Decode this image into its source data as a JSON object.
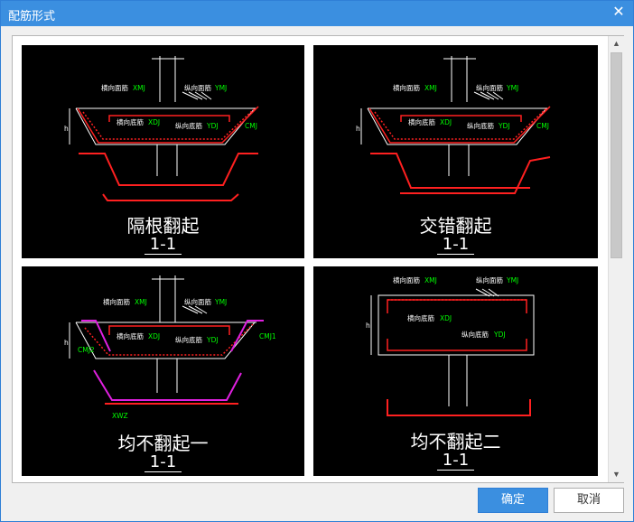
{
  "window": {
    "title": "配筋形式",
    "close_icon": "close-icon"
  },
  "panels": [
    {
      "caption": "隔根翻起",
      "section": "1-1",
      "labels": {
        "top_h": "横向面筋",
        "top_h_code": "XMJ",
        "top_v": "纵向面筋",
        "top_v_code": "YMJ",
        "bot_h": "横向底筋",
        "bot_h_code": "XDJ",
        "bot_v": "纵向底筋",
        "bot_v_code": "YDJ",
        "cmj": "CMJ",
        "h": "h"
      }
    },
    {
      "caption": "交错翻起",
      "section": "1-1",
      "labels": {
        "top_h": "横向面筋",
        "top_h_code": "XMJ",
        "top_v": "纵向面筋",
        "top_v_code": "YMJ",
        "bot_h": "横向底筋",
        "bot_h_code": "XDJ",
        "bot_v": "纵向底筋",
        "bot_v_code": "YDJ",
        "cmj": "CMJ",
        "h": "h"
      }
    },
    {
      "caption": "均不翻起一",
      "section": "1-1",
      "labels": {
        "top_h": "横向面筋",
        "top_h_code": "XMJ",
        "top_v": "纵向面筋",
        "top_v_code": "YMJ",
        "bot_h": "横向底筋",
        "bot_h_code": "XDJ",
        "bot_v": "纵向底筋",
        "bot_v_code": "YDJ",
        "cmj1": "CMJ1",
        "cmj2": "CMJ2",
        "xwz": "XWZ",
        "h": "h"
      }
    },
    {
      "caption": "均不翻起二",
      "section": "1-1",
      "labels": {
        "top_h": "横向面筋",
        "top_h_code": "XMJ",
        "top_v": "纵向面筋",
        "top_v_code": "YMJ",
        "bot_h": "横向底筋",
        "bot_h_code": "XDJ",
        "bot_v": "纵向底筋",
        "bot_v_code": "YDJ",
        "h": "h"
      }
    }
  ],
  "buttons": {
    "ok": "确定",
    "cancel": "取消"
  }
}
